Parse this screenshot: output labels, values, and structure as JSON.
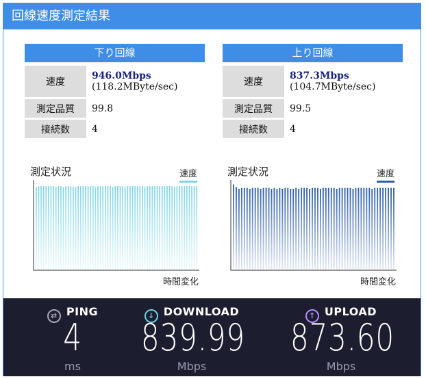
{
  "window": {
    "title": "回線速度測定結果"
  },
  "download": {
    "header": "下り回線",
    "speed_label": "速度",
    "speed_main": "946.0Mbps",
    "speed_sub": "(118.2MByte/sec)",
    "quality_label": "測定品質",
    "quality_value": "99.8",
    "conn_label": "接続数",
    "conn_value": "4",
    "chart_title": "測定状況",
    "legend": "速度",
    "xlabel": "時間変化",
    "color": "#7ed4e6"
  },
  "upload": {
    "header": "上り回線",
    "speed_label": "速度",
    "speed_main": "837.3Mbps",
    "speed_sub": "(104.7MByte/sec)",
    "quality_label": "測定品質",
    "quality_value": "99.5",
    "conn_label": "接続数",
    "conn_value": "4",
    "chart_title": "測定状況",
    "legend": "速度",
    "xlabel": "時間変化",
    "color": "#2e5ea8"
  },
  "ookla": {
    "ping": {
      "label": "PING",
      "value": "4",
      "unit": "ms",
      "icon": "ping-icon"
    },
    "download": {
      "label": "DOWNLOAD",
      "value": "839.99",
      "unit": "Mbps",
      "icon": "download-arrow-icon"
    },
    "upload": {
      "label": "UPLOAD",
      "value": "873.60",
      "unit": "Mbps",
      "icon": "upload-arrow-icon"
    }
  },
  "chart_data": [
    {
      "type": "bar",
      "title": "測定状況",
      "xlabel": "時間変化",
      "ylabel": "",
      "legend": [
        "速度"
      ],
      "series": [
        {
          "name": "速度",
          "values": [
            0.95,
            0.96,
            0.96,
            0.96,
            0.96,
            0.96,
            0.96,
            0.96,
            0.95,
            0.96,
            0.96,
            0.95,
            0.96,
            0.96,
            0.96,
            0.95,
            0.95,
            0.96,
            0.96,
            0.96,
            0.96,
            0.96,
            0.96,
            0.96,
            0.95,
            0.96,
            0.96,
            0.96,
            0.96,
            0.96,
            0.96,
            0.95,
            0.96,
            0.96,
            0.96,
            0.96,
            0.95,
            0.96,
            0.96,
            0.96,
            0.96,
            0.96,
            0.96,
            0.96,
            0.95,
            0.96,
            0.96,
            0.96,
            0.96,
            0.96,
            0.96,
            0.96,
            0.96,
            0.96,
            0.96,
            0.96,
            0.95,
            0.96,
            0.96,
            0.96,
            0.96,
            0.96,
            0.96,
            0.96,
            0.96,
            0.96
          ]
        }
      ],
      "ylim": [
        0,
        1
      ],
      "grid": false
    },
    {
      "type": "bar",
      "title": "測定状況",
      "xlabel": "時間変化",
      "ylabel": "",
      "legend": [
        "速度"
      ],
      "series": [
        {
          "name": "速度",
          "values": [
            0.98,
            0.95,
            0.93,
            0.94,
            0.94,
            0.94,
            0.93,
            0.94,
            0.94,
            0.94,
            0.93,
            0.94,
            0.94,
            0.94,
            0.93,
            0.94,
            0.93,
            0.94,
            0.93,
            0.94,
            0.94,
            0.93,
            0.93,
            0.94,
            0.93,
            0.94,
            0.94,
            0.94,
            0.93,
            0.94,
            0.94,
            0.94,
            0.93,
            0.94,
            0.94,
            0.94,
            0.94,
            0.94,
            0.93,
            0.94,
            0.94,
            0.94,
            0.94,
            0.94,
            0.93,
            0.94,
            0.94,
            0.94,
            0.94,
            0.94,
            0.94,
            0.93,
            0.94,
            0.94,
            0.94,
            0.94,
            0.94,
            0.94,
            0.94,
            0.94
          ]
        }
      ],
      "ylim": [
        0,
        1
      ],
      "grid": false
    }
  ]
}
